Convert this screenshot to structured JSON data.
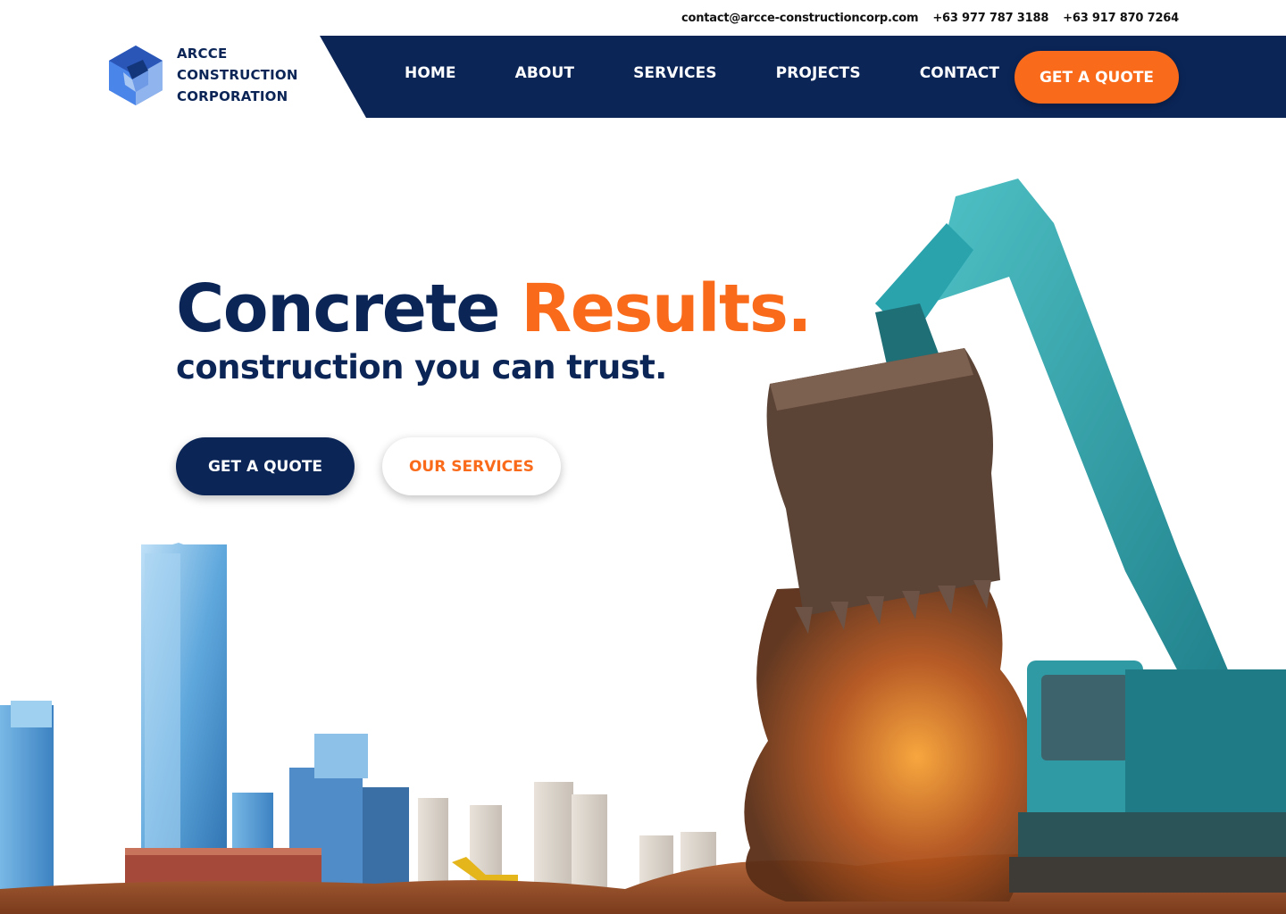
{
  "contact": {
    "email": "contact@arcce-constructioncorp.com",
    "phone1": "+63 977 787 3188",
    "phone2": "+63 917 870 7264"
  },
  "brand": {
    "line1": "ARCCE",
    "line2": "CONSTRUCTION",
    "line3": "CORPORATION",
    "logo_icon": "hexagon-cube-logo"
  },
  "nav": {
    "items": [
      {
        "label": "HOME"
      },
      {
        "label": "ABOUT"
      },
      {
        "label": "SERVICES"
      },
      {
        "label": "PROJECTS"
      },
      {
        "label": "CONTACT"
      }
    ],
    "cta_label": "GET A QUOTE"
  },
  "hero": {
    "title_part1": "Concrete",
    "title_part2": "Results.",
    "subtitle": "construction you can trust.",
    "primary_button": "GET A QUOTE",
    "secondary_button": "OUR SERVICES"
  },
  "colors": {
    "navy": "#0b2557",
    "orange": "#f96b1b",
    "white": "#ffffff"
  }
}
